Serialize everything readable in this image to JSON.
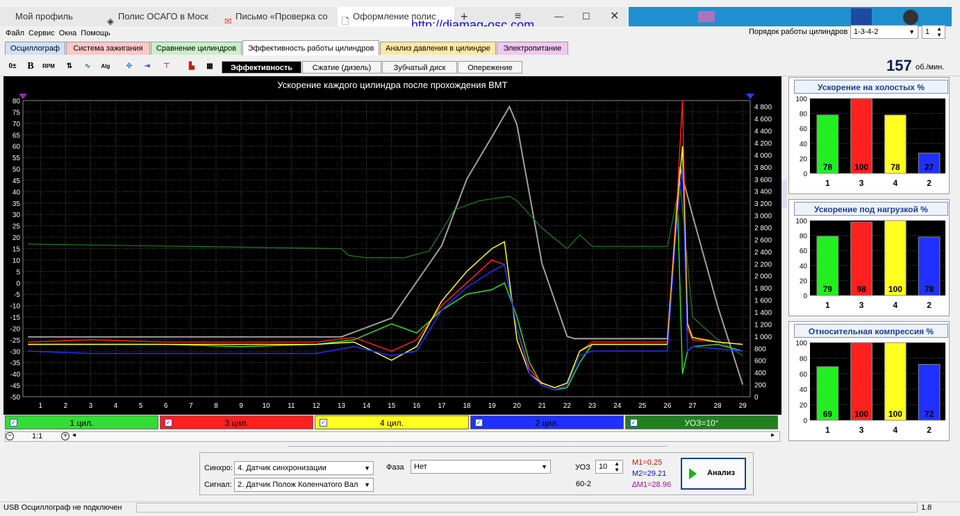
{
  "browser": {
    "tabs": [
      {
        "label": "Мой профиль"
      },
      {
        "label": "Полис ОСАГО в Моск"
      },
      {
        "label": "Письмо «Проверка со"
      },
      {
        "label": "Оформление полис"
      }
    ],
    "new_tab": "+"
  },
  "url_overlay": "http://diamag-osc.com",
  "menu": [
    "Файл",
    "Сервис",
    "Окна",
    "Помощь"
  ],
  "cyl_order": {
    "label": "Порядок работы цилиндров",
    "value": "1-3-4-2",
    "count": "1"
  },
  "main_tabs": [
    {
      "label": "Осциллограф",
      "color": "#cfe0ff"
    },
    {
      "label": "Система зажигания",
      "color": "#ffc8c8"
    },
    {
      "label": "Сравнение цилиндров",
      "color": "#c8f0c8"
    },
    {
      "label": "Эффективность работы цилиндров",
      "color": "#ffffff"
    },
    {
      "label": "Анализ давления в цилиндре",
      "color": "#ffe8a8"
    },
    {
      "label": "Электропитание",
      "color": "#f0c8f0"
    }
  ],
  "sub_tabs": [
    "Эффективность",
    "Сжатие (дизель)",
    "Зубчатый диск",
    "Опережение"
  ],
  "rpm": {
    "value": "157",
    "unit": "об./мин."
  },
  "toolbar_icons": [
    "zero-adjust-icon",
    "bold-b-icon",
    "rpm-icon",
    "scale-icon",
    "curve-icon",
    "alg-icon",
    "filter-icon",
    "numbers-icon",
    "markers-icon",
    "bars-icon",
    "grid-icon"
  ],
  "chart_data": {
    "type": "line",
    "title": "Ускорение каждого цилиндра после прохождения ВМТ",
    "x_ticks": [
      "1",
      "2",
      "3",
      "4",
      "5",
      "6",
      "7",
      "8",
      "9",
      "10",
      "11",
      "12",
      "13",
      "14",
      "15",
      "16",
      "17",
      "18",
      "19",
      "20",
      "21",
      "22",
      "23",
      "24",
      "25",
      "26",
      "27",
      "28",
      "29"
    ],
    "y_left_ticks": [
      "80",
      "75",
      "70",
      "65",
      "60",
      "55",
      "50",
      "45",
      "40",
      "35",
      "30",
      "25",
      "20",
      "15",
      "10",
      "5",
      "0",
      "-5",
      "-10",
      "-15",
      "-20",
      "-25",
      "-30",
      "-35",
      "-40",
      "-45",
      "-50"
    ],
    "y_right_ticks": [
      "4 800",
      "4 600",
      "4 400",
      "4 200",
      "4 000",
      "3 800",
      "3 600",
      "3 400",
      "3 200",
      "3 000",
      "2 800",
      "2 600",
      "2 400",
      "2 200",
      "2 000",
      "1 800",
      "1 600",
      "1 400",
      "1 200",
      "1 000",
      "800",
      "600",
      "400",
      "200",
      "0"
    ],
    "ylim_left": [
      -50,
      80
    ],
    "ylim_right": [
      0,
      4900
    ],
    "series": [
      {
        "name": "1 цил.",
        "color": "#33dd33",
        "x": [
          0.5,
          3,
          6,
          9,
          12,
          13.5,
          15,
          16,
          17,
          18,
          19,
          19.5,
          20,
          20.5,
          21,
          21.5,
          22,
          22.5,
          23,
          25,
          26,
          26.4,
          26.6,
          26.8,
          27,
          28,
          29
        ],
        "y": [
          -27,
          -27,
          -27,
          -28,
          -27,
          -25,
          -18,
          -22,
          -12,
          -5,
          -3,
          0,
          -15,
          -35,
          -45,
          -47,
          -46,
          -35,
          -27,
          -27,
          -27,
          35,
          -40,
          -30,
          -28,
          -27,
          -30
        ]
      },
      {
        "name": "3 цил.",
        "color": "#ff2020",
        "x": [
          0.5,
          3,
          6,
          9,
          12,
          13.5,
          15,
          16,
          17,
          18,
          19,
          19.5,
          20,
          20.5,
          21,
          21.5,
          22,
          22.5,
          23,
          25,
          26,
          26.4,
          26.6,
          26.8,
          27,
          28,
          29
        ],
        "y": [
          -26,
          -25,
          -26,
          -26,
          -26,
          -24,
          -30,
          -25,
          -10,
          0,
          10,
          8,
          -20,
          -38,
          -44,
          -46,
          -44,
          -30,
          -26,
          -26,
          -26,
          40,
          80,
          -20,
          -25,
          -26,
          -27
        ]
      },
      {
        "name": "4 цил.",
        "color": "#ffff20",
        "x": [
          0.5,
          3,
          6,
          9,
          12,
          13.5,
          15,
          16,
          17,
          18,
          19,
          19.5,
          20,
          20.5,
          21,
          21.5,
          22,
          22.5,
          23,
          25,
          26,
          26.4,
          26.6,
          26.8,
          27,
          28,
          29
        ],
        "y": [
          -27,
          -27,
          -27,
          -27,
          -27,
          -26,
          -34,
          -28,
          -8,
          5,
          15,
          18,
          -25,
          -40,
          -44,
          -46,
          -44,
          -30,
          -27,
          -27,
          -27,
          35,
          60,
          -18,
          -24,
          -26,
          -27
        ]
      },
      {
        "name": "2 цил.",
        "color": "#2030ff",
        "x": [
          0.5,
          3,
          6,
          9,
          12,
          13.5,
          15,
          16,
          17,
          18,
          19,
          19.5,
          20,
          20.5,
          21,
          21.5,
          22,
          22.5,
          23,
          25,
          26,
          26.4,
          26.6,
          26.8,
          27,
          28,
          29
        ],
        "y": [
          -30,
          -31,
          -31,
          -31,
          -31,
          -28,
          -32,
          -30,
          -12,
          -2,
          5,
          8,
          -20,
          -40,
          -45,
          -47,
          -45,
          -32,
          -30,
          -30,
          -30,
          30,
          50,
          -30,
          -28,
          -29,
          -30
        ]
      }
    ],
    "rpm_trace": {
      "name": "gray-rpm",
      "color": "#a0a0a0",
      "x": [
        0.5,
        13,
        15,
        17,
        18,
        19,
        19.7,
        20,
        21,
        22,
        22.3,
        23,
        26,
        26.5,
        27,
        28,
        29
      ],
      "y": [
        990,
        990,
        1300,
        2500,
        3600,
        4300,
        4800,
        4500,
        2200,
        1000,
        960,
        960,
        960,
        3800,
        3000,
        1500,
        200
      ]
    },
    "tdc_trace": {
      "name": "УОЗ=10°",
      "color": "#208020",
      "x": [
        0.5,
        13,
        13.3,
        14,
        15.5,
        16.5,
        17.5,
        18.5,
        19.7,
        20,
        21,
        22,
        22.5,
        23,
        26,
        26.5,
        27,
        28,
        29
      ],
      "y": [
        17,
        15,
        12,
        11,
        11,
        14,
        32,
        36,
        38,
        36,
        24,
        15,
        21,
        16,
        16,
        44,
        -15,
        -25,
        -32
      ]
    },
    "legend": [
      "1 цил.",
      "3 цил.",
      "4 цил.",
      "2 цил.",
      "УОЗ=10°"
    ],
    "markers": [
      "purple-triangle-left",
      "blue-triangle-right"
    ]
  },
  "legend_colors": [
    "#33dd33",
    "#ff2020",
    "#ffff20",
    "#2030ff",
    "#208020"
  ],
  "scroll": {
    "zoom": "1:1"
  },
  "panels": [
    {
      "title": "Ускорение на холостых %",
      "order": [
        "1",
        "3",
        "4",
        "2"
      ],
      "values": [
        78,
        100,
        78,
        27
      ],
      "labels": [
        "78",
        "100",
        "78",
        "27"
      ],
      "y_ticks": [
        "100",
        "80",
        "60",
        "40",
        "20",
        "0"
      ]
    },
    {
      "title": "Ускорение под нагрузкой %",
      "order": [
        "1",
        "3",
        "4",
        "2"
      ],
      "values": [
        79,
        98,
        100,
        78
      ],
      "labels": [
        "79",
        "98",
        "100",
        "78"
      ],
      "y_ticks": [
        "100",
        "80",
        "60",
        "40",
        "20",
        "0"
      ]
    },
    {
      "title": "Относительная компрессия %",
      "order": [
        "1",
        "3",
        "4",
        "2"
      ],
      "values": [
        69,
        100,
        100,
        72
      ],
      "labels": [
        "69",
        "100",
        "100",
        "72"
      ],
      "y_ticks": [
        "100",
        "80",
        "60",
        "40",
        "20",
        "0"
      ]
    }
  ],
  "bar_colors": [
    "#22ee22",
    "#ff2020",
    "#ffff20",
    "#2030ff"
  ],
  "bottom": {
    "sync_label": "Синхро:",
    "sync_value": "4. Датчик синхронизации",
    "signal_label": "Сигнал:",
    "signal_value": "2. Датчик Полож Коленчатого Вал",
    "phase_label": "Фаза",
    "phase_value": "Нет",
    "uoz_label": "УОЗ",
    "uoz_value": "10",
    "teeth": "60-2",
    "m1": "M1=0.25",
    "m2": "M2=29.21",
    "dm": "∆M1=28.96",
    "analyze": "Анализ"
  },
  "status": {
    "text": "USB Осциллограф не подключен",
    "version": "1.8"
  }
}
